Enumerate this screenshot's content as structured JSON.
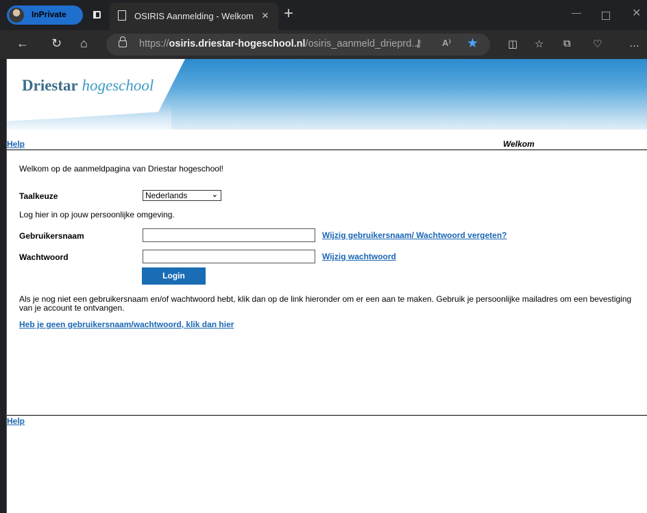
{
  "browser": {
    "inprivate_label": "InPrivate",
    "tab_title": "OSIRIS Aanmelding - Welkom",
    "close_tab": "×",
    "new_tab": "+",
    "url_prefix": "https://",
    "url_host": "osiris.driestar-hogeschool.nl",
    "url_path": "/osiris_aanmeld_drieprd...",
    "read_aloud": "A⁾",
    "nav_icons": [
      "back-icon",
      "refresh-icon",
      "home-icon"
    ],
    "toolbar_icons": [
      "split-screen-icon",
      "favorites-icon",
      "collections-icon",
      "browser-essentials-icon",
      "more-icon"
    ]
  },
  "logo": {
    "part1": "Driestar",
    "part2": "hogeschool"
  },
  "header": {
    "help": "Help",
    "welcome_title": "Welkom"
  },
  "form": {
    "intro": "Welkom op de aanmeldpagina van Driestar hogeschool!",
    "language_label": "Taalkeuze",
    "language_value": "Nederlands",
    "login_instruction": "Log hier in op jouw persoonlijke omgeving.",
    "username_label": "Gebruikersnaam",
    "username_value": "",
    "username_link": "Wijzig gebruikersnaam/ Wachtwoord vergeten?",
    "password_label": "Wachtwoord",
    "password_value": "",
    "password_link": "Wijzig wachtwoord",
    "login_button": "Login",
    "info_text": "Als je nog niet een gebruikersnaam en/of wachtwoord hebt, klik dan op de link hieronder om er een aan te maken. Gebruik je persoonlijke mailadres om een bevestiging van je account te ontvangen.",
    "create_account_link": "Heb je geen gebruikersnaam/wachtwoord, klik dan hier"
  },
  "footer": {
    "help": "Help"
  },
  "colors": {
    "accent": "#1a6cb5",
    "link": "#1a66b5",
    "inprivate": "#1f6fcf"
  }
}
